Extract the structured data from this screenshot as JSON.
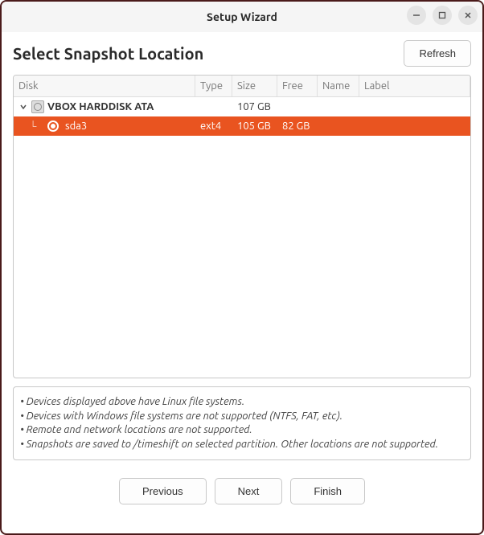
{
  "window": {
    "title": "Setup Wizard"
  },
  "header": {
    "page_title": "Select Snapshot Location",
    "refresh_label": "Refresh"
  },
  "columns": {
    "disk": "Disk",
    "type": "Type",
    "size": "Size",
    "free": "Free",
    "name": "Name",
    "label": "Label"
  },
  "rows": {
    "parent": {
      "disk": "VBOX HARDDISK ATA",
      "type": "",
      "size": "107 GB",
      "free": "",
      "name": "",
      "label": ""
    },
    "child": {
      "disk": "sda3",
      "type": "ext4",
      "size": "105 GB",
      "free": "82 GB",
      "name": "",
      "label": ""
    }
  },
  "notes": {
    "line1": "Devices displayed above have Linux file systems.",
    "line2": "Devices with Windows file systems are not supported (NTFS, FAT, etc).",
    "line3": "Remote and network locations are not supported.",
    "line4": "Snapshots are saved to /timeshift on selected partition. Other locations are not supported."
  },
  "footer": {
    "previous": "Previous",
    "next": "Next",
    "finish": "Finish"
  }
}
